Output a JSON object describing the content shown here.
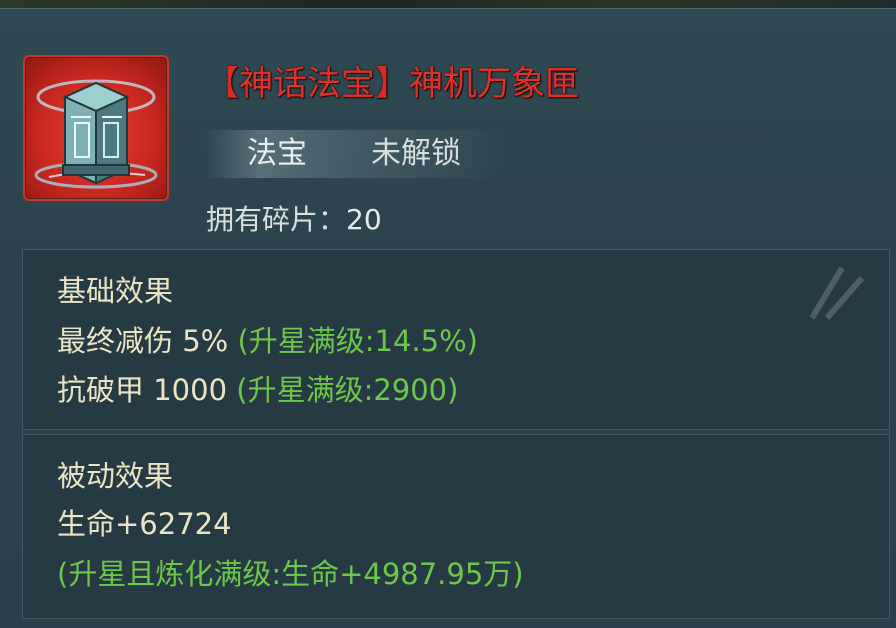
{
  "item": {
    "bracket_left": "【",
    "category": "神话法宝",
    "bracket_right": "】",
    "name": "神机万象匣",
    "type": "法宝",
    "status": "未解锁",
    "fragments_label": "拥有碎片：",
    "fragments_count": "20",
    "icon": "mechanism-box-icon"
  },
  "base_effect": {
    "heading": "基础效果",
    "lines": [
      {
        "text": "最终减伤 5%",
        "max": "(升星满级:14.5%)"
      },
      {
        "text": "抗破甲 1000",
        "max": "(升星满级:2900)"
      }
    ]
  },
  "passive_effect": {
    "heading": "被动效果",
    "value": "生命+62724",
    "max": "(升星且炼化满级:生命+4987.95万)"
  },
  "colors": {
    "title_red": "#e0302a",
    "text_cream": "#eae4c6",
    "max_green": "#6dc54a",
    "panel": "#2b434d"
  }
}
